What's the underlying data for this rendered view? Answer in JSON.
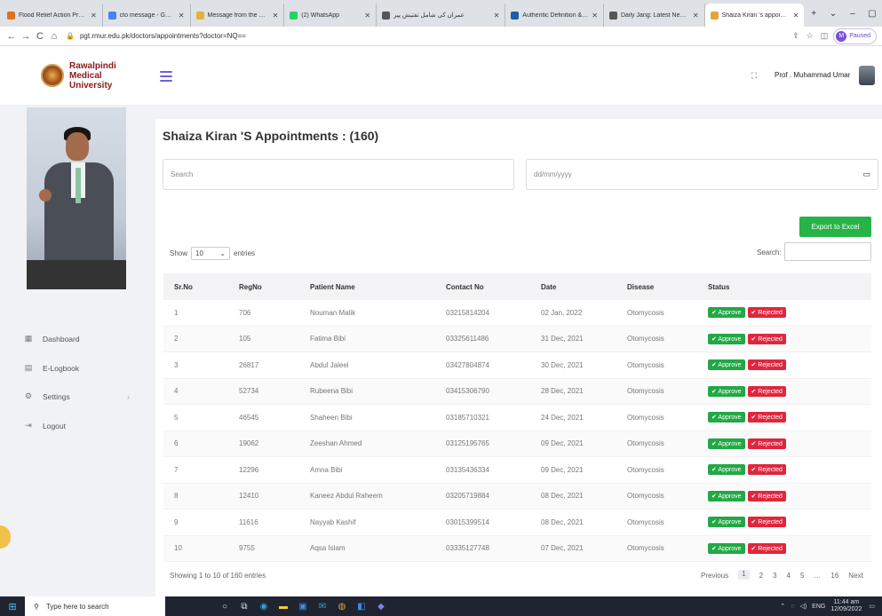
{
  "browser": {
    "tabs": [
      {
        "label": "Flood Relief Action Progra",
        "color": "#e0701e"
      },
      {
        "label": "cto message - Google Sea",
        "color": "#4285f4"
      },
      {
        "label": "Message from the CTO - J",
        "color": "#e2b23a"
      },
      {
        "label": "(2) WhatsApp",
        "color": "#25d366"
      },
      {
        "label": "عمران کی شامل تفتیش پیر",
        "color": "#555555"
      },
      {
        "label": "Authentic Definition & Me",
        "color": "#1b5fa8"
      },
      {
        "label": "Daily Jang: Latest News, B",
        "color": "#555555"
      },
      {
        "label": "Shaiza Kiran 's appointme",
        "color": "#e6a23c",
        "active": true
      }
    ],
    "url": "pgt.rmur.edu.pk/doctors/appointments?doctor=NQ==",
    "profile_status": "Paused",
    "profile_initial": "M"
  },
  "app": {
    "university": "Rawalpindi Medical University",
    "user_name": "Prof . Muhammad Umar"
  },
  "sidebar": {
    "items": [
      {
        "label": "Dashboard",
        "icon": "grid-icon"
      },
      {
        "label": "E-Logbook",
        "icon": "book-icon"
      },
      {
        "label": "Settings",
        "icon": "gear-icon"
      },
      {
        "label": "Logout",
        "icon": "logout-icon"
      }
    ]
  },
  "main": {
    "title": "Shaiza Kiran 'S Appointments : (160)",
    "search_placeholder": "Search",
    "date_placeholder": "dd/mm/yyyy",
    "export_label": "Export to Excel",
    "show_label": "Show",
    "show_value": "10",
    "entries_label": "entries",
    "search_label": "Search:",
    "columns": [
      "Sr.No",
      "RegNo",
      "Patient Name",
      "Contact No",
      "Date",
      "Disease",
      "Status"
    ],
    "rows": [
      [
        "1",
        "706",
        "Nouman Malik",
        "03215814204",
        "02 Jan, 2022",
        "Otomycosis"
      ],
      [
        "2",
        "105",
        "Fatima Bibi",
        "03325611486",
        "31 Dec, 2021",
        "Otomycosis"
      ],
      [
        "3",
        "26817",
        "Abdul Jaleel",
        "03427804874",
        "30 Dec, 2021",
        "Otomycosis"
      ],
      [
        "4",
        "52734",
        "Rubeena Bibi",
        "03415306790",
        "28 Dec, 2021",
        "Otomycosis"
      ],
      [
        "5",
        "46545",
        "Shaheen Bibi",
        "03185710321",
        "24 Dec, 2021",
        "Otomycosis"
      ],
      [
        "6",
        "19062",
        "Zeeshan Ahmed",
        "03125195765",
        "09 Dec, 2021",
        "Otomycosis"
      ],
      [
        "7",
        "12296",
        "Amna Bibi",
        "03135436334",
        "09 Dec, 2021",
        "Otomycosis"
      ],
      [
        "8",
        "12410",
        "Kaneez Abdul Raheem",
        "03205719884",
        "08 Dec, 2021",
        "Otomycosis"
      ],
      [
        "9",
        "11616",
        "Nayyab Kashif",
        "03015399514",
        "08 Dec, 2021",
        "Otomycosis"
      ],
      [
        "10",
        "9755",
        "Aqsa Islam",
        "03335127748",
        "07 Dec, 2021",
        "Otomycosis"
      ]
    ],
    "approve_label": "✔ Approve",
    "reject_label": "✔ Rejected",
    "info": "Showing 1 to 10 of 160 entries",
    "pager": [
      "Previous",
      "1",
      "2",
      "3",
      "4",
      "5",
      "…",
      "16",
      "Next"
    ]
  },
  "taskbar": {
    "search_placeholder": "Type here to search",
    "lang": "ENG",
    "time": "11:44 am",
    "date": "12/09/2022"
  }
}
